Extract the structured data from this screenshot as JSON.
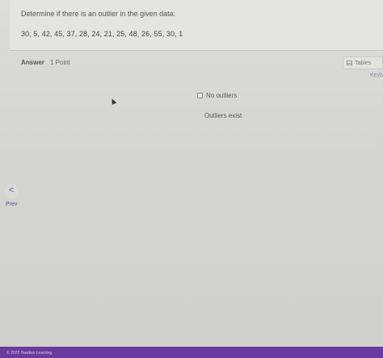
{
  "question": {
    "prompt": "Determine if there is an outlier in the given data:",
    "data": "30, 5, 42, 45, 37, 28, 24, 21, 25, 48, 26, 55, 30, 1"
  },
  "answer": {
    "label": "Answer",
    "points": "1 Point",
    "tables_label": "Tables",
    "keypad_label": "Keyb"
  },
  "options": [
    {
      "label": "No outliers",
      "selected": false
    },
    {
      "label": "Outliers exist",
      "selected": false
    }
  ],
  "nav": {
    "prev_icon": "<",
    "prev_label": "Prev"
  },
  "footer": {
    "text": "© 2023 Hawkes Learning"
  },
  "colors": {
    "footer": "#6a3a9e",
    "link": "#4a5a8a"
  }
}
